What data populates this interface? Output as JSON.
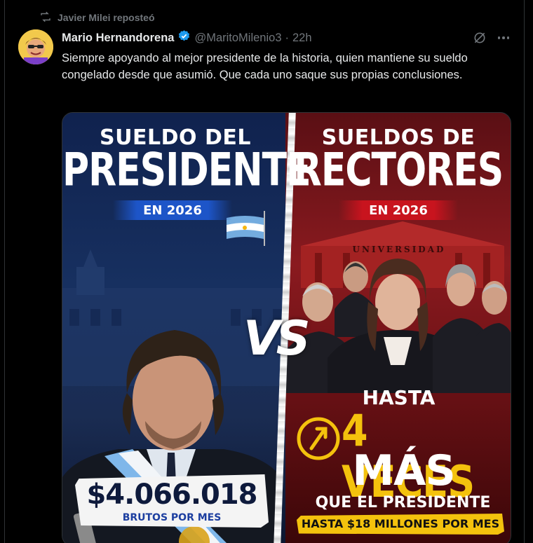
{
  "repost": {
    "text": "Javier Milei reposteó",
    "icon": "repost-icon"
  },
  "author": {
    "name": "Mario Hernandorena",
    "verified_icon": "verified-badge-icon",
    "handle": "@MaritoMilenio3",
    "separator": "·",
    "time": "22h"
  },
  "actions": {
    "grok_icon": "grok-icon",
    "more_icon": "more-icon"
  },
  "tweet": {
    "text": "Siempre apoyando al mejor presidente de la historia, quien mantiene su sueldo congelado desde que asumió. Que cada uno saque sus propias conclusiones."
  },
  "media": {
    "left": {
      "title_small": "SUELDO DEL",
      "title_large": "PRESIDENTE",
      "year": "EN 2026",
      "amount": "$4.066.018",
      "amount_sub": "BRUTOS POR MES"
    },
    "vs": "VS",
    "right": {
      "title_small": "SUELDOS DE",
      "title_large": "RECTORES",
      "year": "EN 2026",
      "building_label": "UNIVERSIDAD",
      "hasta": "HASTA",
      "veces": "4 VECES",
      "mas": "MÁS",
      "que": "QUE EL PRESIDENTE",
      "millones": "HASTA $18 MILLONES POR MES"
    },
    "colors": {
      "left_accent": "#1d55c8",
      "right_accent": "#c8141e",
      "highlight": "#f4c20d"
    }
  }
}
